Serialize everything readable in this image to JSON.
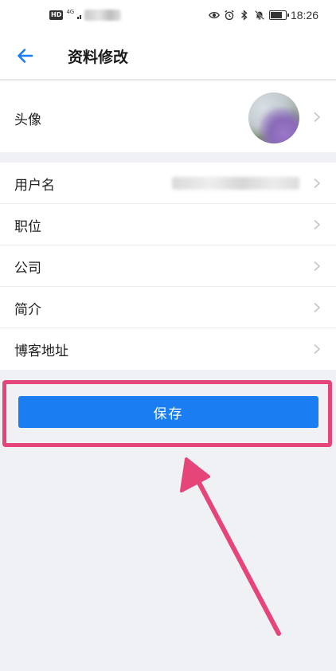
{
  "status_bar": {
    "network_badge": "HD",
    "network_type": "4G",
    "time": "18:26",
    "battery_percent": 75,
    "icons": [
      "eye-icon",
      "alarm-icon",
      "bluetooth-icon",
      "mute-icon",
      "battery-icon"
    ]
  },
  "header": {
    "title": "资料修改",
    "back_icon": "back-arrow-icon"
  },
  "avatar_row": {
    "label": "头像"
  },
  "fields": [
    {
      "label": "用户名"
    },
    {
      "label": "职位"
    },
    {
      "label": "公司"
    },
    {
      "label": "简介"
    },
    {
      "label": "博客地址"
    }
  ],
  "save_button": {
    "label": "保存"
  },
  "colors": {
    "accent": "#1a7ef2",
    "annotation": "#e6457a",
    "background": "#eff1f4"
  }
}
